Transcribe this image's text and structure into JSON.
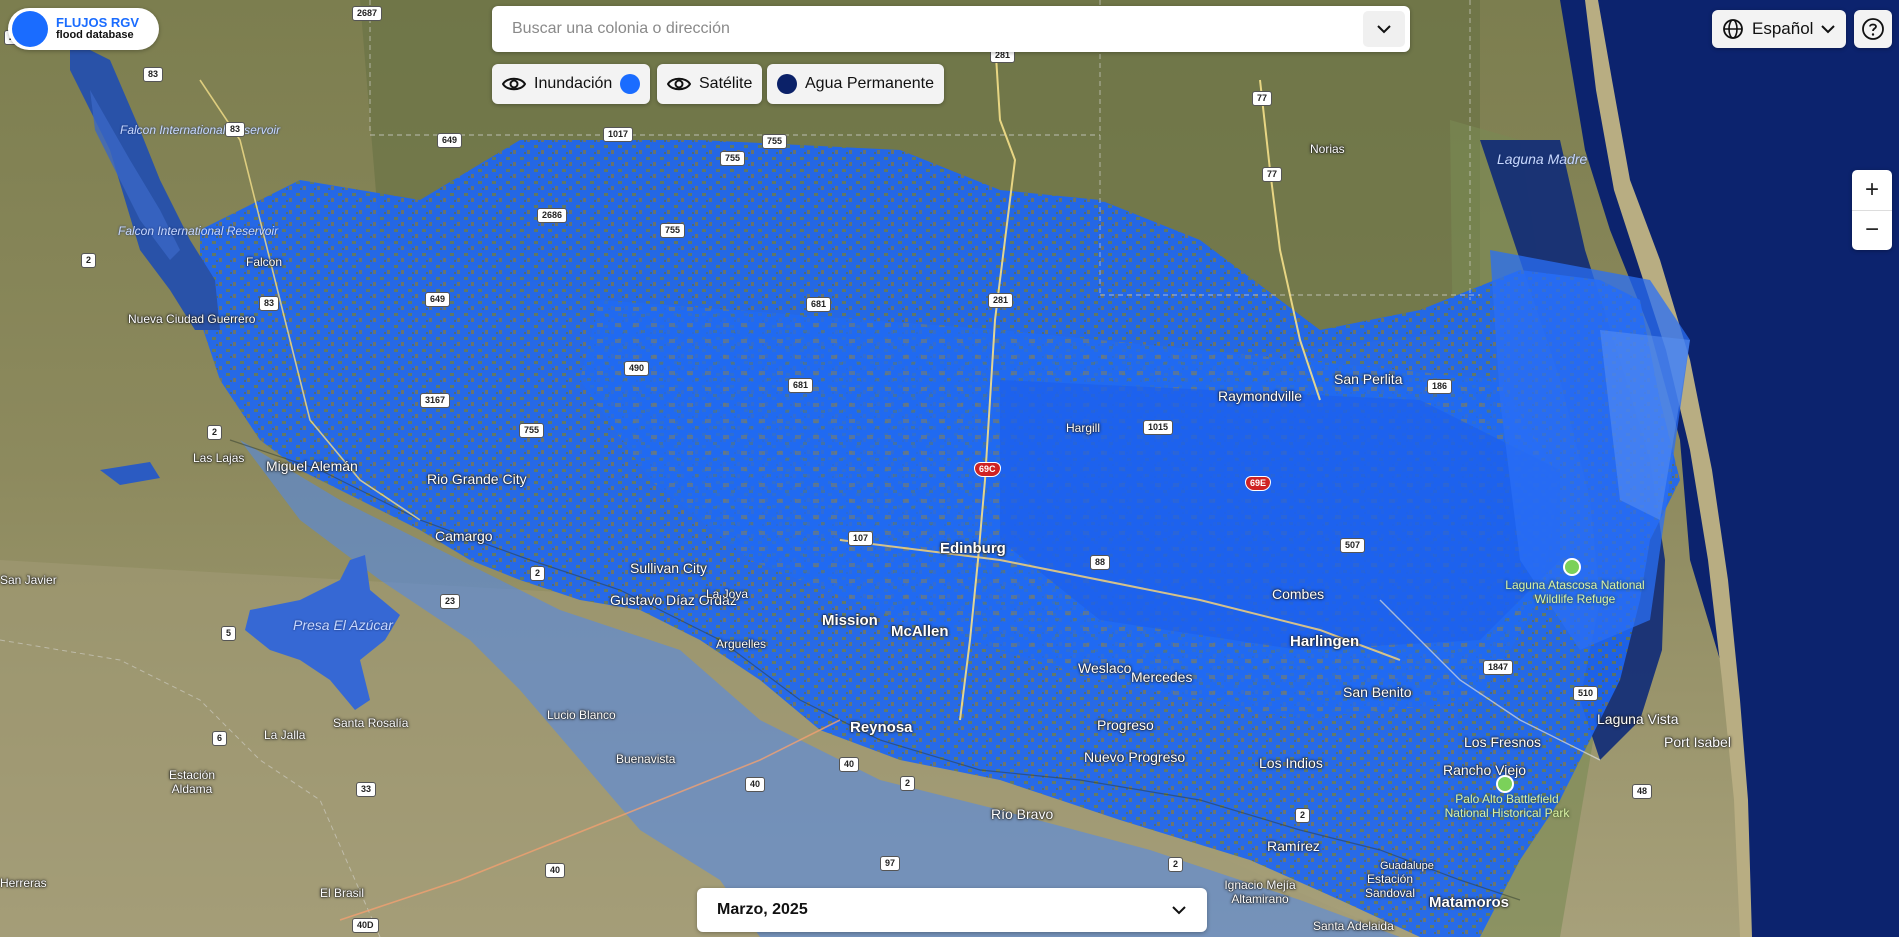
{
  "brand": {
    "title": "FLUJOS RGV",
    "subtitle": "flood database"
  },
  "search": {
    "placeholder": "Buscar una colonia o dirección"
  },
  "layers": [
    {
      "label": "Inundación",
      "icon": "eye-icon",
      "color": "#1a6cff"
    },
    {
      "label": "Satélite",
      "icon": "eye-icon"
    },
    {
      "label": "Agua Permanente",
      "color": "#0b2168"
    }
  ],
  "language": {
    "label": "Español"
  },
  "zoom": {
    "in": "+",
    "out": "−"
  },
  "date": {
    "value": "Marzo, 2025"
  },
  "colors": {
    "flood": "#1a6cff",
    "permanent_water": "#0b2168",
    "land": "#8f8b5f"
  },
  "map": {
    "places": [
      "Falcon International Reservoir",
      "Falcon International Reservoir",
      "Falcon",
      "Nueva Ciudad Guerrero",
      "Las Lajas",
      "Miguel Alemán",
      "Rio Grande City",
      "Camargo",
      "Sullivan City",
      "Gustavo Díaz Ordaz",
      "La Joya",
      "Mission",
      "McAllen",
      "Edinburg",
      "Weslaco",
      "Mercedes",
      "Harlingen",
      "San Benito",
      "Combes",
      "Raymondville",
      "San Perlita",
      "Hargill",
      "Norias",
      "Laguna Madre",
      "Laguna Atascosa National Wildlife Refuge",
      "Laguna Vista",
      "Port Isabel",
      "Los Fresnos",
      "Rancho Viejo",
      "Palo Alto Battlefield National Historical Park",
      "Los Indios",
      "Progreso",
      "Nuevo Progreso",
      "Reynosa",
      "Río Bravo",
      "Ramírez",
      "Ignacio Mejía Altamirano",
      "Estación Sandoval",
      "Guadalupe",
      "Matamoros",
      "Santa Adelaida",
      "Presa El Azúcar",
      "Arguelles",
      "Lucio Blanco",
      "Buenavista",
      "Santa Rosalía",
      "La Jalla",
      "Estación Aldama",
      "El Brasil",
      "San Javier",
      "Herreras"
    ],
    "roads": [
      "2687",
      "83",
      "83",
      "83",
      "649",
      "649",
      "1017",
      "755",
      "755",
      "755",
      "755",
      "2686",
      "681",
      "681",
      "490",
      "3167",
      "281",
      "281",
      "77",
      "77",
      "1015",
      "107",
      "88",
      "507",
      "186",
      "1847",
      "510",
      "48",
      "2",
      "2",
      "2",
      "2",
      "2",
      "2",
      "2",
      "23",
      "5",
      "6",
      "33",
      "40",
      "40",
      "40",
      "97",
      "40D",
      "69C",
      "69E"
    ]
  }
}
